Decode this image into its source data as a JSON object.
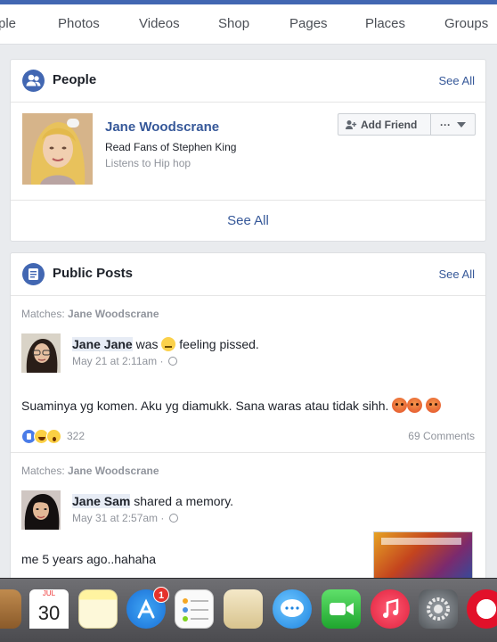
{
  "tabs": [
    "ple",
    "Photos",
    "Videos",
    "Shop",
    "Pages",
    "Places",
    "Groups"
  ],
  "people": {
    "title": "People",
    "see_all_link": "See All",
    "person": {
      "name": "Jane Woodscrane",
      "line1": "Read Fans of Stephen King",
      "line2": "Listens to Hip hop"
    },
    "add_friend_label": "Add Friend",
    "more_label": "···",
    "see_all_bottom": "See All"
  },
  "public_posts": {
    "title": "Public Posts",
    "see_all_link": "See All",
    "posts": [
      {
        "matches_label": "Matches:",
        "matches_name": "Jane Woodscrane",
        "author": "Jane Jane",
        "action_pre": "was",
        "action_post": "feeling pissed.",
        "time": "May 21 at 2:11am ·",
        "text": "Suaminya yg komen. Aku yg diamukk. Sana waras atau tidak sihh.",
        "reaction_count": "322",
        "comments": "69 Comments"
      },
      {
        "matches_label": "Matches:",
        "matches_name": "Jane Woodscrane",
        "author": "Jane Sam",
        "action_post": "shared a memory.",
        "time": "May 31 at 2:57am ·",
        "text": "me 5 years ago..hahaha"
      }
    ]
  },
  "dock": {
    "calendar_month": "JUL",
    "calendar_day": "30",
    "app_store_badge": "1"
  },
  "colors": {
    "link_blue": "#365899",
    "brand_blue": "#4267b2",
    "badge_red": "#e5322b"
  }
}
